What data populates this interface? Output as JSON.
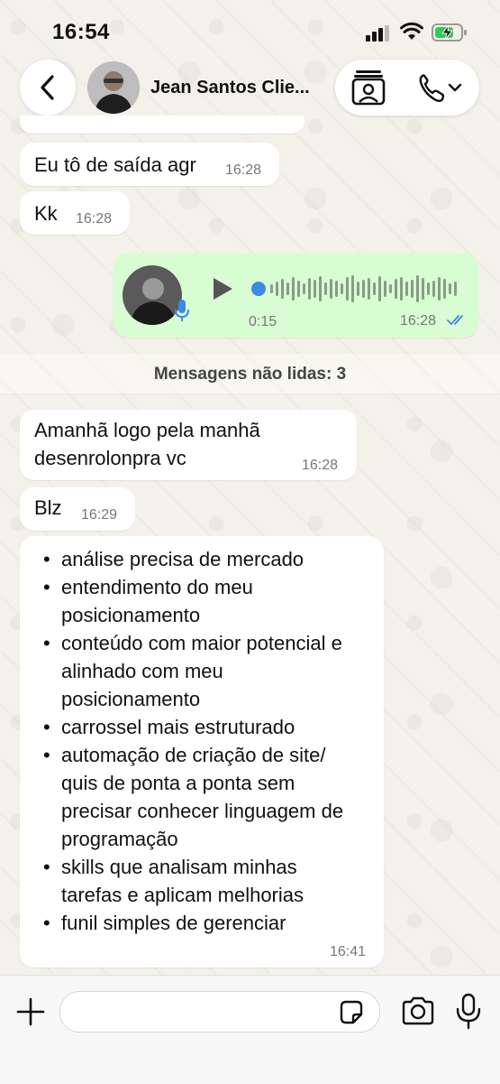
{
  "status_bar": {
    "time": "16:54"
  },
  "header": {
    "contact_name": "Jean Santos Clie..."
  },
  "messages": [
    {
      "text": "Eu tô de saída agr",
      "time": "16:28"
    },
    {
      "text": "Kk",
      "time": "16:28"
    },
    {
      "type": "voice",
      "duration": "0:15",
      "time": "16:28",
      "status": "read"
    },
    {
      "text_lines": [
        "Amanhã logo pela manhã",
        "desenrolonpra vc"
      ],
      "time": "16:28"
    },
    {
      "text": "Blz",
      "time": "16:29"
    },
    {
      "bullets": [
        [
          "análise precisa de mercado"
        ],
        [
          "entendimento do meu",
          "posicionamento"
        ],
        [
          "conteúdo com maior potencial e",
          "alinhado com meu",
          "posicionamento"
        ],
        [
          "carrossel mais estruturado"
        ],
        [
          "automação de criação de site/",
          "quis de ponta a ponta sem",
          "precisar conhecer linguagem de",
          "programação"
        ],
        [
          "skills que analisam minhas",
          "tarefas e aplicam melhorias"
        ],
        [
          "funil simples de gerenciar"
        ]
      ],
      "time": "16:41"
    }
  ],
  "unread_divider": "Mensagens não lidas: 3",
  "colors": {
    "incoming": "#ffffff",
    "outgoing": "#d9fdd3",
    "accent": "#3b8ae6",
    "wallpaper": "#f4f1ea"
  }
}
